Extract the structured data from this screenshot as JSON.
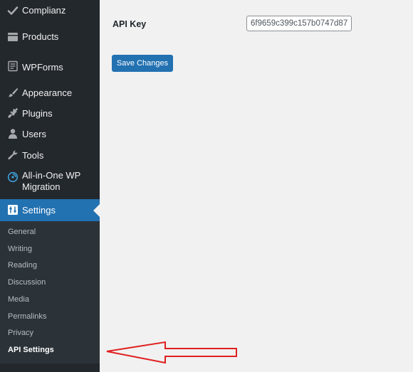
{
  "sidebar": {
    "items": [
      {
        "label": "Complianz",
        "icon": "checkmark-icon"
      },
      {
        "label": "Products",
        "icon": "products-icon"
      },
      {
        "label": "WPForms",
        "icon": "wpforms-icon"
      },
      {
        "label": "Appearance",
        "icon": "paintbrush-icon"
      },
      {
        "label": "Plugins",
        "icon": "plug-icon"
      },
      {
        "label": "Users",
        "icon": "user-icon"
      },
      {
        "label": "Tools",
        "icon": "wrench-icon"
      },
      {
        "label": "All-in-One WP Migration",
        "label_line1": "All-in-One WP",
        "label_line2": "Migration",
        "icon": "migration-icon"
      },
      {
        "label": "Settings",
        "icon": "settings-icon",
        "active": true
      }
    ],
    "submenu": [
      {
        "label": "General"
      },
      {
        "label": "Writing"
      },
      {
        "label": "Reading"
      },
      {
        "label": "Discussion"
      },
      {
        "label": "Media"
      },
      {
        "label": "Permalinks"
      },
      {
        "label": "Privacy"
      },
      {
        "label": "API Settings",
        "current": true
      }
    ]
  },
  "main": {
    "api_key_label": "API Key",
    "api_key_value": "6f9659c399c157b0747d87",
    "save_button_label": "Save Changes"
  },
  "annotation": {
    "arrow_color": "#e02020",
    "arrow_target": "API Settings"
  },
  "colors": {
    "sidebar_bg": "#23282d",
    "submenu_bg": "#2c3338",
    "accent": "#2271b1",
    "content_bg": "#f1f1f1"
  }
}
